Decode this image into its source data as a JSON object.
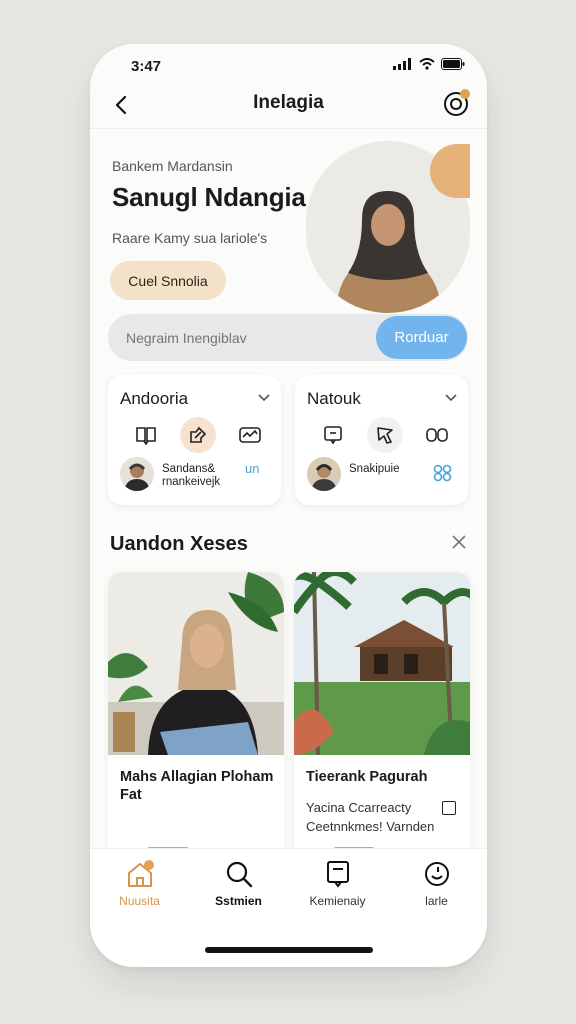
{
  "status": {
    "time": "3:47"
  },
  "header": {
    "title": "Inelagia"
  },
  "hero": {
    "overline": "Bankem Mardansin",
    "title": "Sanugl Ndangia",
    "subtitle": "Raare Kamy sua lariole's",
    "button_label": "Cuel Snnolia"
  },
  "search": {
    "placeholder": "Negraim Inengiblav",
    "button_label": "Rorduar"
  },
  "cards": [
    {
      "title": "Andooria",
      "meta_line1": "Sandans&",
      "meta_line2": "rnankeivejk",
      "end_glyph": "un"
    },
    {
      "title": "Natouk",
      "meta_line1": "Snakipuie",
      "meta_line2": "",
      "end_glyph": ""
    }
  ],
  "section": {
    "title": "Uandon Xeses"
  },
  "photos": [
    {
      "title": "Mahs Allagian Ploham Fat",
      "desc": ""
    },
    {
      "title": "Tieerank Pagurah",
      "desc": "Yacina Ccarreacty Ceetnnkmes! Varnden"
    }
  ],
  "nav": [
    {
      "label": "Nuusita",
      "active": true
    },
    {
      "label": "Sstmien",
      "active": false
    },
    {
      "label": "Kemienaiy",
      "active": false
    },
    {
      "label": "larle",
      "active": false
    }
  ],
  "colors": {
    "accent": "#e3a158",
    "search_button": "#71b5ec",
    "hero_button": "#f3e2c9"
  }
}
